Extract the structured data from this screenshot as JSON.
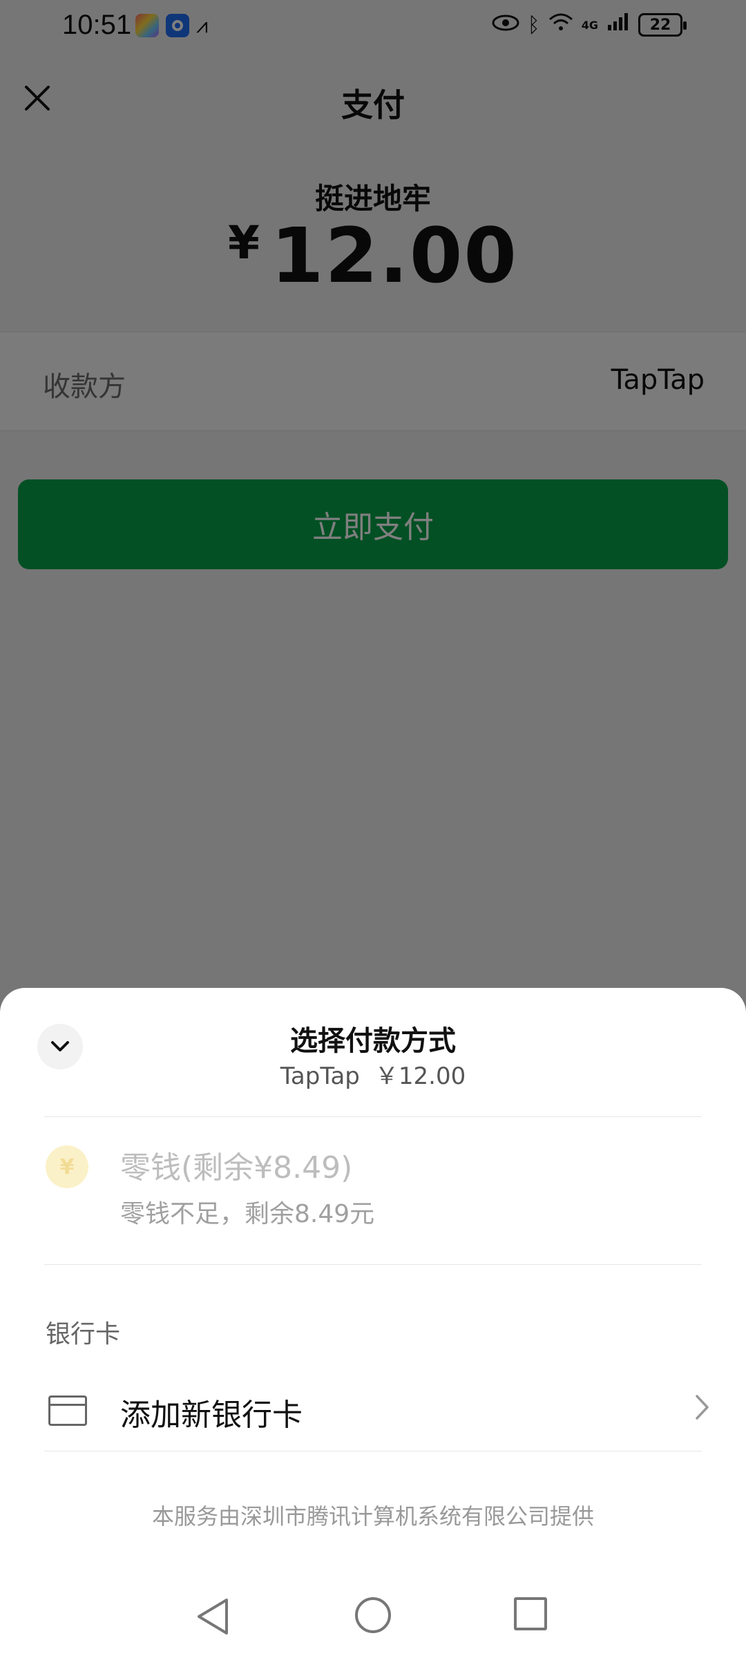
{
  "status_bar": {
    "time": "10:51",
    "network_label": "4G",
    "battery": "22"
  },
  "header": {
    "title": "支付"
  },
  "order": {
    "product_name": "挺进地牢",
    "currency_symbol": "¥",
    "amount": "12.00"
  },
  "payee": {
    "label": "收款方",
    "value": "TapTap"
  },
  "pay_button": {
    "label": "立即支付",
    "color": "#07a049"
  },
  "payment_sheet": {
    "title": "选择付款方式",
    "subtitle_payee": "TapTap",
    "subtitle_amount": "￥12.00",
    "wallet": {
      "coin_symbol": "¥",
      "title": "零钱(剩余¥8.49)",
      "note": "零钱不足，剩余8.49元"
    },
    "bank_section_label": "银行卡",
    "add_card_label": "添加新银行卡",
    "footer": "本服务由深圳市腾讯计算机系统有限公司提供"
  },
  "icons": {
    "close": "close-icon",
    "collapse": "chevron-down-icon",
    "chevron": "chevron-right-icon",
    "card": "bank-card-icon"
  }
}
